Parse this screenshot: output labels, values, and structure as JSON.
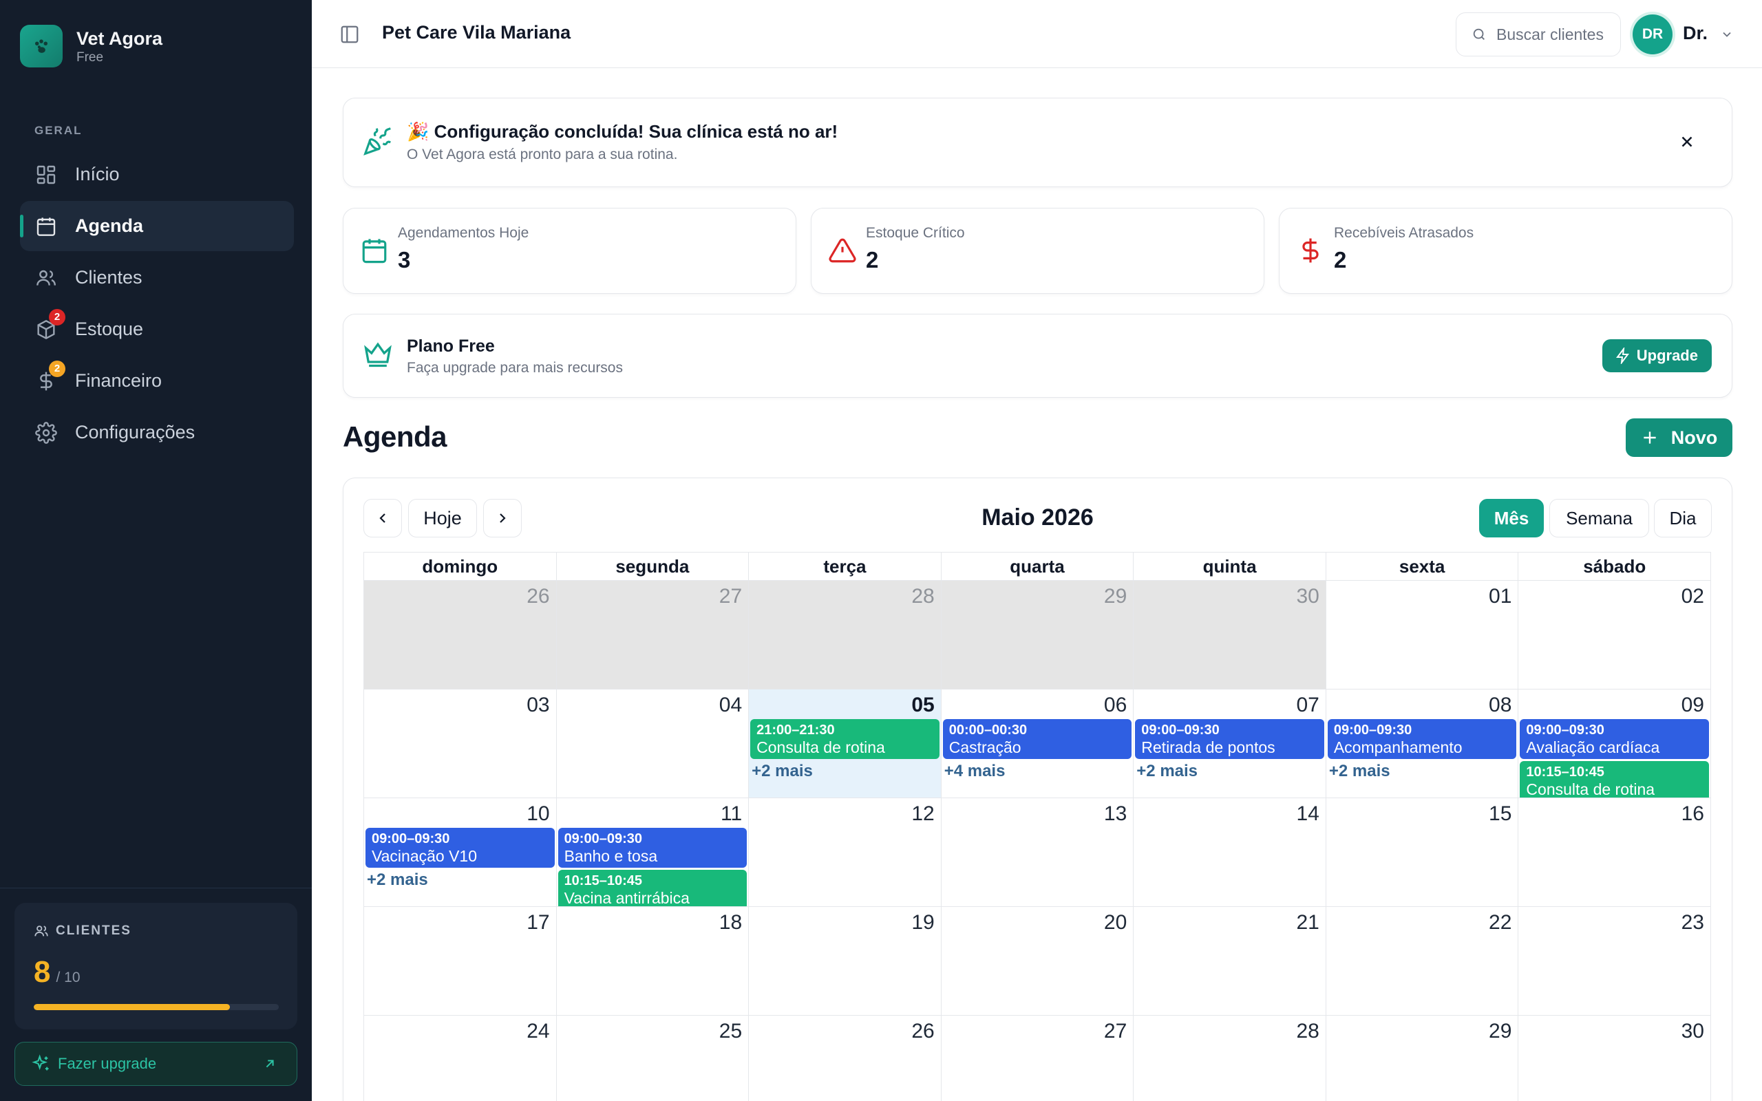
{
  "brand": {
    "name": "Vet Agora",
    "plan": "Free"
  },
  "sidebar": {
    "section_label": "GERAL",
    "items": [
      {
        "label": "Início",
        "icon": "grid-icon",
        "active": false,
        "badge": ""
      },
      {
        "label": "Agenda",
        "icon": "calendar-icon",
        "active": true,
        "badge": ""
      },
      {
        "label": "Clientes",
        "icon": "users-icon",
        "active": false,
        "badge": ""
      },
      {
        "label": "Estoque",
        "icon": "package-icon",
        "active": false,
        "badge": "2",
        "badge_color": "#dc2626"
      },
      {
        "label": "Financeiro",
        "icon": "dollar-icon",
        "active": false,
        "badge": "2",
        "badge_color": "#f5a524"
      },
      {
        "label": "Configurações",
        "icon": "gear-icon",
        "active": false,
        "badge": ""
      }
    ],
    "clients_card": {
      "label": "CLIENTES",
      "count": "8",
      "max": "/ 10",
      "usage_fraction": 0.8
    },
    "upgrade_label": "Fazer upgrade"
  },
  "header": {
    "clinic_name": "Pet Care Vila Mariana",
    "search_placeholder": "Buscar clientes",
    "user_initials": "DR",
    "user_name": "Dr."
  },
  "banner": {
    "emoji": "🎉",
    "title": "Configuração concluída! Sua clínica está no ar!",
    "subtitle": "O Vet Agora está pronto para a sua rotina."
  },
  "stats": [
    {
      "label": "Agendamentos Hoje",
      "value": "3",
      "icon": "calendar-icon",
      "color": "#14a38b"
    },
    {
      "label": "Estoque Crítico",
      "value": "2",
      "icon": "alert-triangle-icon",
      "color": "#dc2626"
    },
    {
      "label": "Recebíveis Atrasados",
      "value": "2",
      "icon": "dollar-icon",
      "color": "#dc2626"
    }
  ],
  "plan": {
    "title": "Plano Free",
    "subtitle": "Faça upgrade para mais recursos",
    "button": "Upgrade"
  },
  "agenda": {
    "title": "Agenda",
    "new_button": "Novo",
    "today_button": "Hoje",
    "month_label": "Maio 2026",
    "views": [
      {
        "label": "Mês",
        "active": true
      },
      {
        "label": "Semana",
        "active": false
      },
      {
        "label": "Dia",
        "active": false
      }
    ],
    "weekdays": [
      "domingo",
      "segunda",
      "terça",
      "quarta",
      "quinta",
      "sexta",
      "sábado"
    ],
    "weeks": [
      [
        {
          "day": "26",
          "other": true
        },
        {
          "day": "27",
          "other": true
        },
        {
          "day": "28",
          "other": true
        },
        {
          "day": "29",
          "other": true
        },
        {
          "day": "30",
          "other": true
        },
        {
          "day": "01"
        },
        {
          "day": "02"
        }
      ],
      [
        {
          "day": "03"
        },
        {
          "day": "04"
        },
        {
          "day": "05",
          "today": true,
          "events": [
            {
              "time": "21:00–21:30",
              "title": "Consulta de rotina",
              "color": "green"
            }
          ],
          "more": "+2 mais"
        },
        {
          "day": "06",
          "events": [
            {
              "time": "00:00–00:30",
              "title": "Castração",
              "color": "blue"
            }
          ],
          "more": "+4 mais"
        },
        {
          "day": "07",
          "events": [
            {
              "time": "09:00–09:30",
              "title": "Retirada de pontos",
              "color": "blue"
            }
          ],
          "more": "+2 mais"
        },
        {
          "day": "08",
          "events": [
            {
              "time": "09:00–09:30",
              "title": "Acompanhamento",
              "color": "blue"
            }
          ],
          "more": "+2 mais"
        },
        {
          "day": "09",
          "events": [
            {
              "time": "09:00–09:30",
              "title": "Avaliação cardíaca",
              "color": "blue"
            },
            {
              "time": "10:15–10:45",
              "title": "Consulta de rotina",
              "color": "green"
            }
          ]
        }
      ],
      [
        {
          "day": "10",
          "events": [
            {
              "time": "09:00–09:30",
              "title": "Vacinação V10",
              "color": "blue"
            }
          ],
          "more": "+2 mais"
        },
        {
          "day": "11",
          "events": [
            {
              "time": "09:00–09:30",
              "title": "Banho e tosa",
              "color": "blue"
            },
            {
              "time": "10:15–10:45",
              "title": "Vacina antirrábica",
              "color": "green"
            }
          ]
        },
        {
          "day": "12"
        },
        {
          "day": "13"
        },
        {
          "day": "14"
        },
        {
          "day": "15"
        },
        {
          "day": "16"
        }
      ],
      [
        {
          "day": "17"
        },
        {
          "day": "18"
        },
        {
          "day": "19"
        },
        {
          "day": "20"
        },
        {
          "day": "21"
        },
        {
          "day": "22"
        },
        {
          "day": "23"
        }
      ],
      [
        {
          "day": "24"
        },
        {
          "day": "25"
        },
        {
          "day": "26"
        },
        {
          "day": "27"
        },
        {
          "day": "28"
        },
        {
          "day": "29"
        },
        {
          "day": "30"
        }
      ]
    ]
  }
}
